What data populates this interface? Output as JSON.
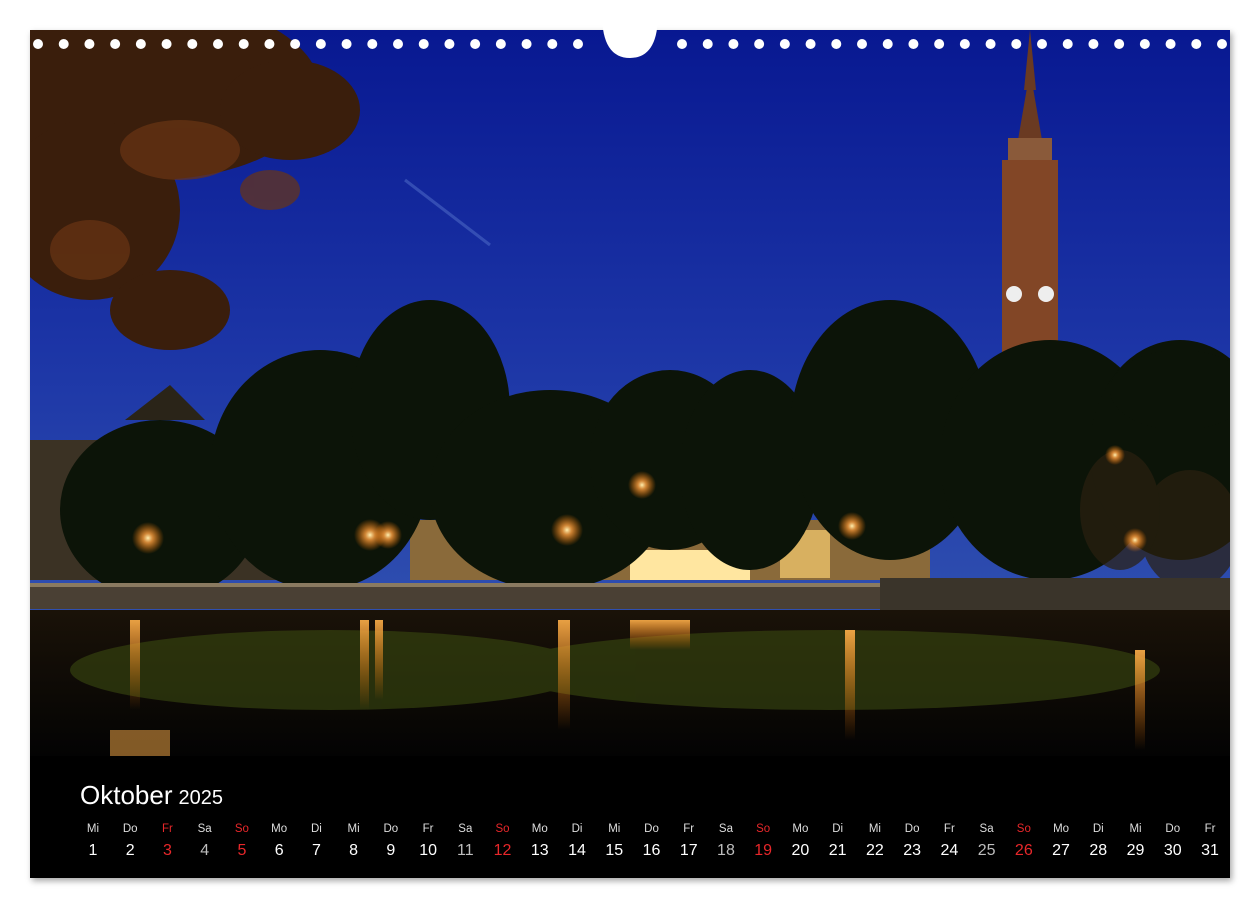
{
  "calendar": {
    "month": "Oktober",
    "year": "2025",
    "days": [
      {
        "name": "Mi",
        "num": "1",
        "kind": "weekday"
      },
      {
        "name": "Do",
        "num": "2",
        "kind": "weekday"
      },
      {
        "name": "Fr",
        "num": "3",
        "kind": "holiday"
      },
      {
        "name": "Sa",
        "num": "4",
        "kind": "saturday"
      },
      {
        "name": "So",
        "num": "5",
        "kind": "sunday"
      },
      {
        "name": "Mo",
        "num": "6",
        "kind": "weekday"
      },
      {
        "name": "Di",
        "num": "7",
        "kind": "weekday"
      },
      {
        "name": "Mi",
        "num": "8",
        "kind": "weekday"
      },
      {
        "name": "Do",
        "num": "9",
        "kind": "weekday"
      },
      {
        "name": "Fr",
        "num": "10",
        "kind": "weekday"
      },
      {
        "name": "Sa",
        "num": "11",
        "kind": "saturday"
      },
      {
        "name": "So",
        "num": "12",
        "kind": "sunday"
      },
      {
        "name": "Mo",
        "num": "13",
        "kind": "weekday"
      },
      {
        "name": "Di",
        "num": "14",
        "kind": "weekday"
      },
      {
        "name": "Mi",
        "num": "15",
        "kind": "weekday"
      },
      {
        "name": "Do",
        "num": "16",
        "kind": "weekday"
      },
      {
        "name": "Fr",
        "num": "17",
        "kind": "weekday"
      },
      {
        "name": "Sa",
        "num": "18",
        "kind": "saturday"
      },
      {
        "name": "So",
        "num": "19",
        "kind": "sunday"
      },
      {
        "name": "Mo",
        "num": "20",
        "kind": "weekday"
      },
      {
        "name": "Di",
        "num": "21",
        "kind": "weekday"
      },
      {
        "name": "Mi",
        "num": "22",
        "kind": "weekday"
      },
      {
        "name": "Do",
        "num": "23",
        "kind": "weekday"
      },
      {
        "name": "Fr",
        "num": "24",
        "kind": "weekday"
      },
      {
        "name": "Sa",
        "num": "25",
        "kind": "saturday"
      },
      {
        "name": "So",
        "num": "26",
        "kind": "sunday"
      },
      {
        "name": "Mo",
        "num": "27",
        "kind": "weekday"
      },
      {
        "name": "Di",
        "num": "28",
        "kind": "weekday"
      },
      {
        "name": "Mi",
        "num": "29",
        "kind": "weekday"
      },
      {
        "name": "Do",
        "num": "30",
        "kind": "weekday"
      },
      {
        "name": "Fr",
        "num": "31",
        "kind": "weekday"
      }
    ]
  },
  "photo": {
    "subject": "night-river-town-church-tower",
    "colors": {
      "sky_top": "#0a1a8c",
      "sky_bottom": "#2d45a8",
      "lamp": "#ffb347",
      "water": "#050505"
    }
  },
  "colors": {
    "accent_red": "#e8272a",
    "bar_bg": "#000000",
    "text": "#ffffff"
  },
  "binding": {
    "hole_count_left": 22,
    "hole_count_right": 22
  }
}
